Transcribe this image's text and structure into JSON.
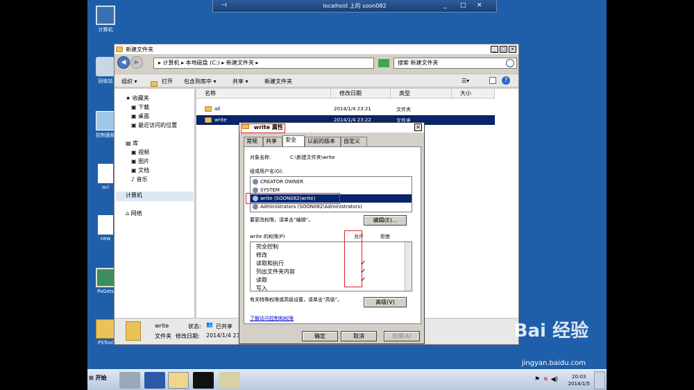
{
  "remote_bar": {
    "title": "localhost 上的 soon082",
    "pin": "⊣",
    "minimize": "_",
    "restore": "□",
    "close": "✕"
  },
  "desktop_icons": [
    {
      "label": "计算机"
    },
    {
      "label": "回收站"
    },
    {
      "label": "控制面板"
    },
    {
      "label": "acl"
    },
    {
      "label": "new"
    },
    {
      "label": "PsGets"
    },
    {
      "label": "PSTool"
    }
  ],
  "explorer": {
    "title": "新建文件夹",
    "address": "▸ 计算机 ▸ 本地磁盘 (C:) ▸ 新建文件夹 ▸",
    "search_placeholder": "搜索 新建文件夹",
    "toolbar": {
      "organize": "组织 ▾",
      "open": "打开",
      "include_in_library": "包含到库中 ▾",
      "share": "共享 ▾",
      "new_folder": "新建文件夹"
    },
    "nav": {
      "favorites": "收藏夹",
      "downloads": "下载",
      "desktop": "桌面",
      "recent": "最近访问的位置",
      "libraries": "库",
      "videos": "视频",
      "pictures": "图片",
      "documents": "文档",
      "music": "音乐",
      "computer": "计算机",
      "network": "网络"
    },
    "columns": {
      "name": "名称",
      "date": "修改日期",
      "type": "类型",
      "size": "大小"
    },
    "files": [
      {
        "name": "all",
        "date": "2014/1/4 23:21",
        "type": "文件夹"
      },
      {
        "name": "write",
        "date": "2014/1/4 23:22",
        "type": "文件夹"
      }
    ],
    "details": {
      "name": "write",
      "state_label": "状态:",
      "state_value": "已共享",
      "type": "文件夹",
      "modified_label": "修改日期:",
      "modified_value": "2014/1/4 23"
    }
  },
  "dialog": {
    "title": "write 属性",
    "tabs": [
      "常规",
      "共享",
      "安全",
      "以前的版本",
      "自定义"
    ],
    "object_label": "对象名称:",
    "object_value": "C:\\新建文件夹\\write",
    "group_label": "组或用户名(G):",
    "users": [
      "CREATOR OWNER",
      "SYSTEM",
      "write (SOON082\\write)",
      "Administrators (SOON082\\Administrators)"
    ],
    "change_hint": "要更改权限，请单击“编辑”。",
    "edit_button": "编辑(E)...",
    "perm_label": "write 的权限(P)",
    "allow_header": "允许",
    "deny_header": "拒绝",
    "permissions": [
      {
        "name": "完全控制",
        "allow": ""
      },
      {
        "name": "修改",
        "allow": ""
      },
      {
        "name": "读取和执行",
        "allow": "✓"
      },
      {
        "name": "列出文件夹内容",
        "allow": "✓"
      },
      {
        "name": "读取",
        "allow": "✓"
      },
      {
        "name": "写入",
        "allow": ""
      }
    ],
    "advanced_hint": "有关特殊权限或高级设置，请单击“高级”。",
    "advanced_button": "高级(V)",
    "link": "了解访问控制和权限",
    "ok": "确定",
    "cancel": "取消",
    "apply": "应用(A)"
  },
  "taskbar": {
    "start": "开始",
    "time": "20:03",
    "date": "2014/1/5"
  },
  "watermark": {
    "brand": "Bai 经验",
    "url": "jingyan.baidu.com"
  }
}
